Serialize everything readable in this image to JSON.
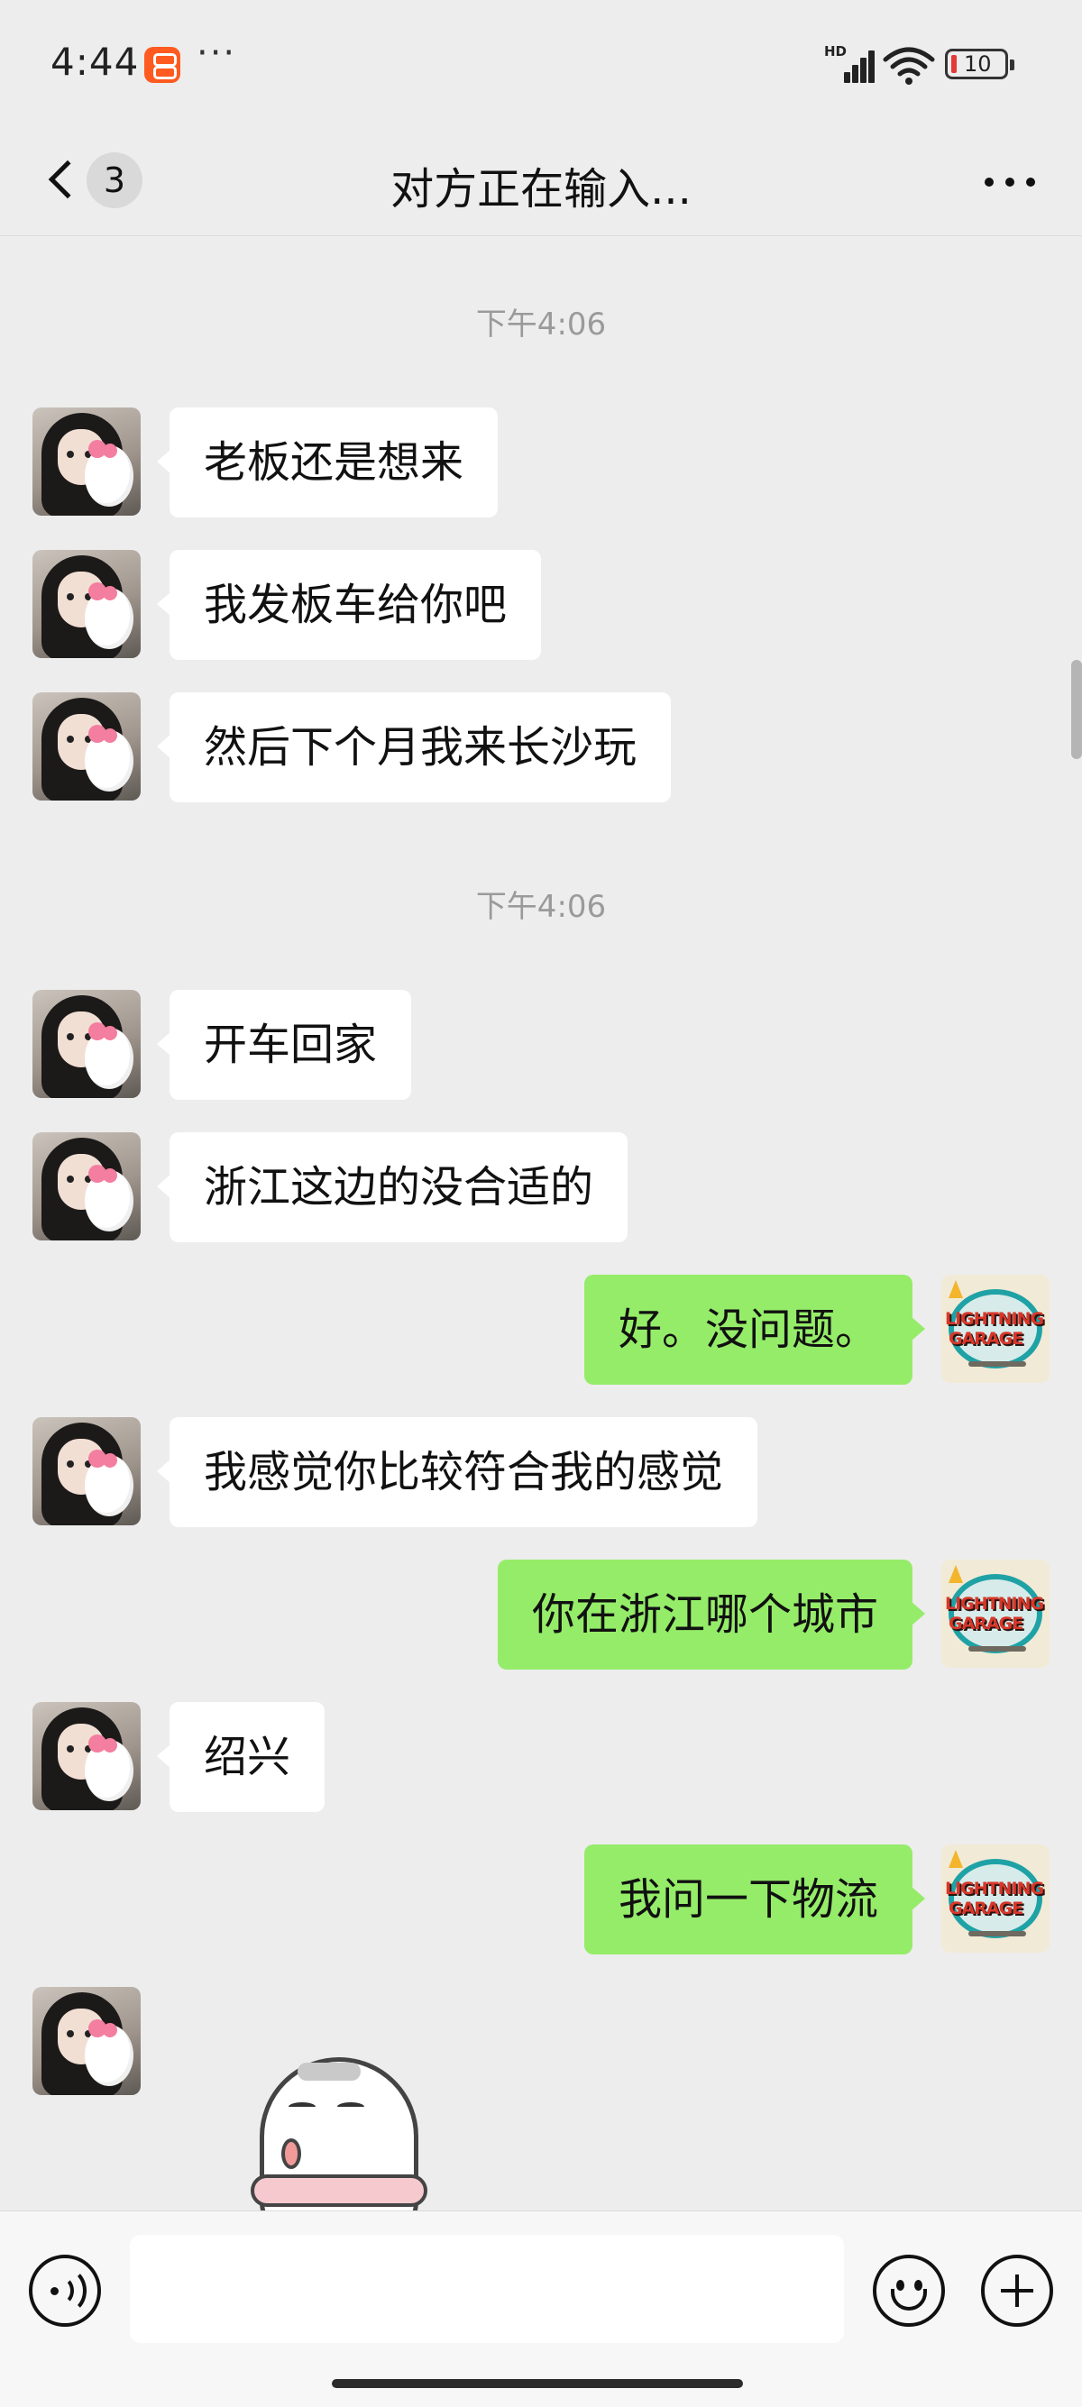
{
  "status_bar": {
    "time": "4:44",
    "more": "···",
    "network_label": "HD",
    "battery_level": "10",
    "battery_color": "#e53935",
    "app_badge_color": "#ff5a1f"
  },
  "nav": {
    "unread_count": "3",
    "title": "对方正在输入...",
    "back_icon": "chevron-left-icon",
    "more_icon": "more-dots-icon"
  },
  "chat": {
    "time_separators": [
      "下午4:06",
      "下午4:06"
    ],
    "messages": [
      {
        "side": "left",
        "text": "老板还是想来"
      },
      {
        "side": "left",
        "text": "我发板车给你吧"
      },
      {
        "side": "left",
        "text": "然后下个月我来长沙玩"
      },
      {
        "side": "left",
        "text": "开车回家"
      },
      {
        "side": "left",
        "text": "浙江这边的没合适的"
      },
      {
        "side": "right",
        "text": "好。没问题。"
      },
      {
        "side": "left",
        "text": "我感觉你比较符合我的感觉"
      },
      {
        "side": "right",
        "text": "你在浙江哪个城市"
      },
      {
        "side": "left",
        "text": "绍兴"
      },
      {
        "side": "right",
        "text": "我问一下物流"
      },
      {
        "side": "left",
        "type": "sticker",
        "sticker": "seal-sticker"
      }
    ],
    "colors": {
      "incoming_bubble": "#ffffff",
      "outgoing_bubble": "#95ec69",
      "background": "#ededed"
    },
    "self_avatar": {
      "logo_line1": "LIGHTNING",
      "logo_line2": "GARAGE"
    }
  },
  "input_bar": {
    "voice_icon": "voice-icon",
    "input_value": "",
    "input_placeholder": "",
    "emoji_icon": "emoji-icon",
    "plus_icon": "plus-icon"
  }
}
